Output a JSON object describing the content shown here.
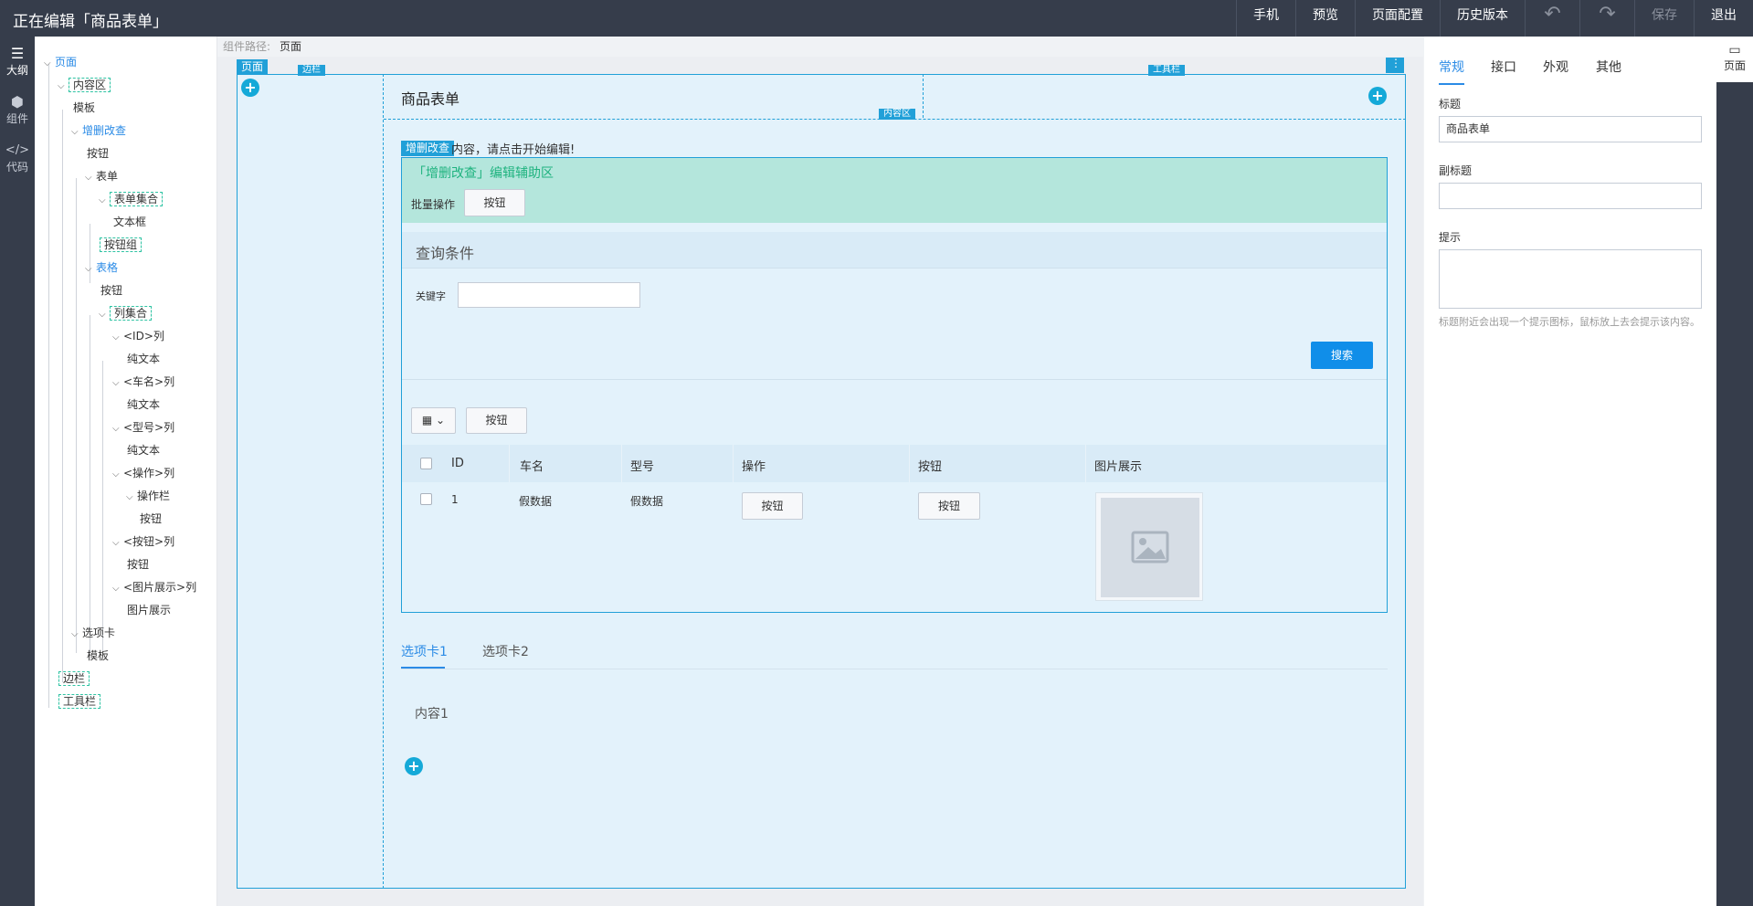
{
  "header": {
    "title": "正在编辑「商品表单」",
    "actions": {
      "mobile": "手机",
      "preview": "预览",
      "page_config": "页面配置",
      "history": "历史版本",
      "undo": "↶",
      "redo": "↷",
      "save": "保存",
      "exit": "退出"
    }
  },
  "left_rail": {
    "outline": "大纲",
    "components": "组件",
    "code": "代码"
  },
  "outline_tree": [
    "页面",
    "内容区",
    "模板",
    "增删改查",
    "按钮",
    "表单",
    "表单集合",
    "文本框",
    "按钮组",
    "表格",
    "按钮",
    "列集合",
    "<ID>列",
    "纯文本",
    "<车名>列",
    "纯文本",
    "<型号>列",
    "纯文本",
    "<操作>列",
    "操作栏",
    "按钮",
    "<按钮>列",
    "按钮",
    "<图片展示>列",
    "图片展示",
    "选项卡",
    "模板",
    "边栏",
    "工具栏"
  ],
  "breadcrumb": {
    "label": "组件路径:",
    "value": "页面"
  },
  "canvas": {
    "tags": {
      "page": "页面",
      "sidebar": "边栏",
      "toolbar": "工具栏",
      "content": "内容区",
      "crud": "增删改查"
    },
    "page_title": "商品表单",
    "crud_hint": "内容，请点击开始编辑!",
    "helper": {
      "title": "「增删改查」编辑辅助区",
      "bulk_label": "批量操作",
      "bulk_button": "按钮"
    },
    "query": {
      "title": "查询条件",
      "keyword_label": "关键字",
      "keyword_value": "",
      "search_button": "搜索"
    },
    "toolbar": {
      "columns_icon": "grid-icon",
      "button": "按钮"
    },
    "table": {
      "headers": [
        "ID",
        "车名",
        "型号",
        "操作",
        "按钮",
        "图片展示"
      ],
      "rows": [
        {
          "id": "1",
          "name": "假数据",
          "model": "假数据",
          "op_button": "按钮",
          "button": "按钮"
        }
      ]
    },
    "tabs": [
      "选项卡1",
      "选项卡2"
    ],
    "tab_content": "内容1"
  },
  "right_panel": {
    "tabs": [
      "常规",
      "接口",
      "外观",
      "其他"
    ],
    "fields": {
      "title_label": "标题",
      "title_value": "商品表单",
      "subtitle_label": "副标题",
      "subtitle_value": "",
      "tip_label": "提示",
      "tip_value": "",
      "tip_help": "标题附近会出现一个提示图标，鼠标放上去会提示该内容。"
    },
    "page_mode_label": "页面"
  },
  "colors": {
    "topbar": "#363d4b",
    "accent": "#2b8be6",
    "primary_button": "#108ee9",
    "canvas_bg": "#e3f2fb",
    "helper_bg": "#b4e6dc",
    "tag": "#21a0d8"
  }
}
